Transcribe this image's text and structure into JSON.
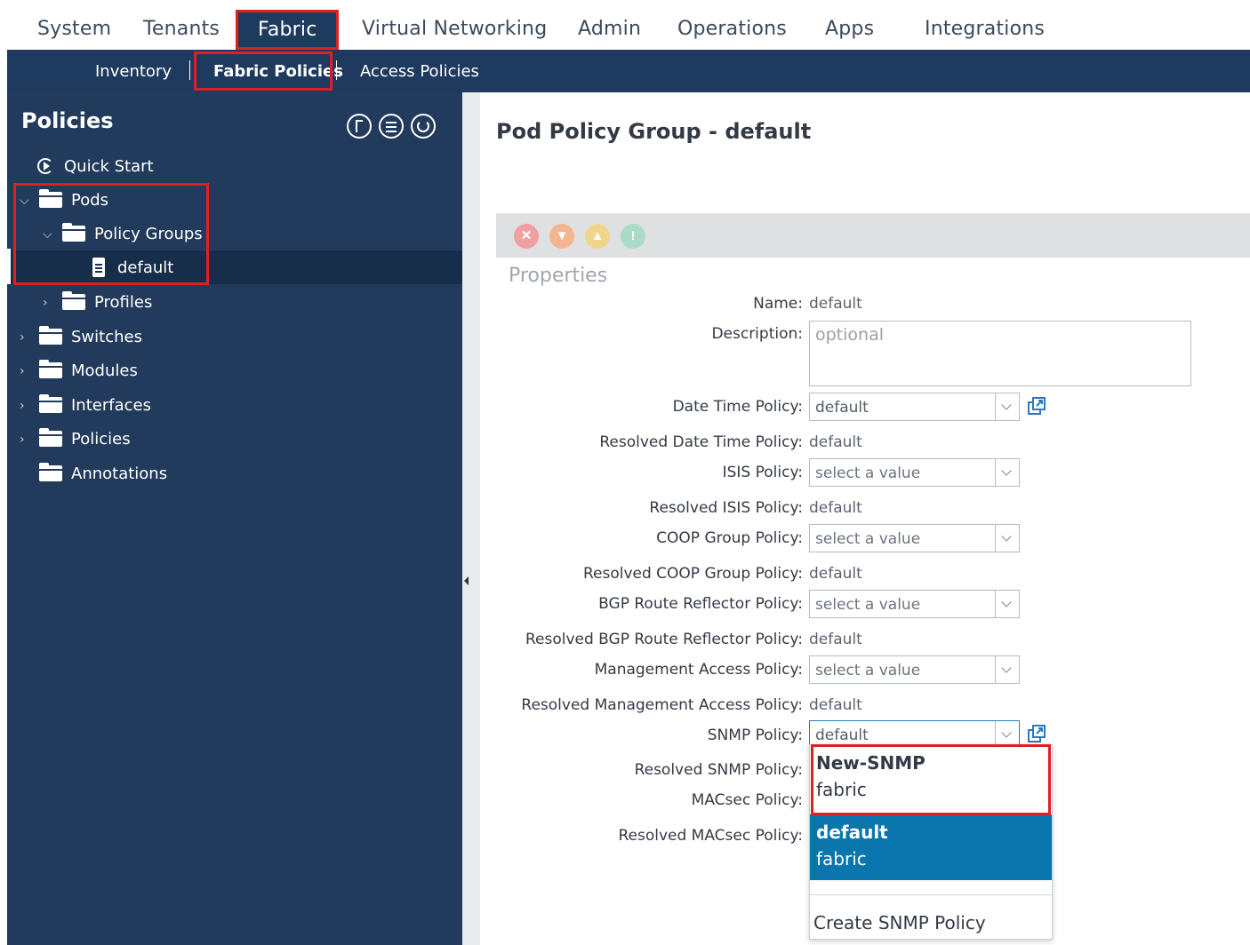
{
  "top_nav": {
    "tabs": [
      "System",
      "Tenants",
      "Fabric",
      "Virtual Networking",
      "Admin",
      "Operations",
      "Apps",
      "Integrations"
    ],
    "active": "Fabric"
  },
  "sub_nav": {
    "items": [
      "Inventory",
      "Fabric Policies",
      "Access Policies"
    ],
    "active": "Fabric Policies"
  },
  "sidebar": {
    "title": "Policies",
    "items": {
      "quick_start": "Quick Start",
      "pods": "Pods",
      "policy_groups": "Policy Groups",
      "default": "default",
      "profiles": "Profiles",
      "switches": "Switches",
      "modules": "Modules",
      "interfaces": "Interfaces",
      "policies": "Policies",
      "annotations": "Annotations"
    }
  },
  "main": {
    "title": "Pod Policy Group - default",
    "properties_label": "Properties",
    "fields": {
      "name_label": "Name:",
      "name_value": "default",
      "description_label": "Description:",
      "description_placeholder": "optional",
      "date_time_label": "Date Time Policy:",
      "date_time_value": "default",
      "resolved_date_time_label": "Resolved Date Time Policy:",
      "resolved_date_time_value": "default",
      "isis_label": "ISIS Policy:",
      "isis_value": "select a value",
      "resolved_isis_label": "Resolved ISIS Policy:",
      "resolved_isis_value": "default",
      "coop_label": "COOP Group Policy:",
      "coop_value": "select a value",
      "resolved_coop_label": "Resolved COOP Group Policy:",
      "resolved_coop_value": "default",
      "bgp_label": "BGP Route Reflector Policy:",
      "bgp_value": "select a value",
      "resolved_bgp_label": "Resolved BGP Route Reflector Policy:",
      "resolved_bgp_value": "default",
      "mgmt_label": "Management Access Policy:",
      "mgmt_value": "select a value",
      "resolved_mgmt_label": "Resolved Management Access Policy:",
      "resolved_mgmt_value": "default",
      "snmp_label": "SNMP Policy:",
      "snmp_value": "default",
      "resolved_snmp_label": "Resolved SNMP Policy:",
      "macsec_label": "MACsec Policy:",
      "resolved_macsec_label": "Resolved MACsec Policy:"
    },
    "dropdown": {
      "options": [
        {
          "name": "New-SNMP",
          "sub": "fabric"
        },
        {
          "name": "default",
          "sub": "fabric"
        }
      ],
      "create_label": "Create SNMP Policy"
    }
  },
  "colors": {
    "nav_dark": "#1f3a5f",
    "sidebar_bg": "#223b5c",
    "highlight_red": "#e02020",
    "dropdown_selected": "#0b75ad"
  }
}
